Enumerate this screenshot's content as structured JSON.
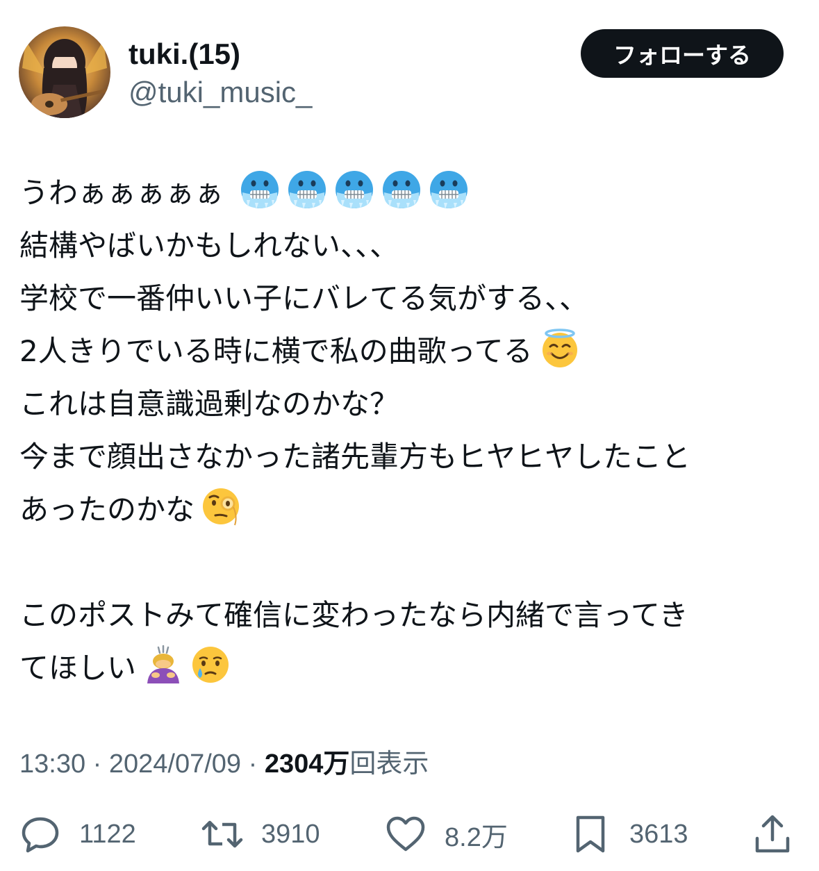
{
  "profile": {
    "display_name": "tuki.(15)",
    "handle": "@tuki_music_"
  },
  "follow_button": {
    "label": "フォローする"
  },
  "tweet": {
    "lines": [
      "うわぁぁぁぁぁ",
      "結構やばいかもしれない、、、",
      "学校で一番仲いい子にバレてる気がする、、",
      "2人きりでいる時に横で私の曲歌ってる",
      "これは自意識過剰なのかな？",
      "今まで顔出さなかった諸先輩方もヒヤヒヤしたこと",
      "あったのかな",
      "このポストみて確信に変わったなら内緒で言ってき",
      "てほしい"
    ],
    "emojis": {
      "line1": [
        "cold-face",
        "cold-face",
        "cold-face",
        "cold-face",
        "cold-face"
      ],
      "line4": [
        "smiling-face-with-halo"
      ],
      "line7": [
        "face-with-monocle"
      ],
      "line9": [
        "person-bowing",
        "face-holding-back-tears"
      ]
    }
  },
  "meta": {
    "time": "13:30",
    "separator": " · ",
    "date": "2024/07/09",
    "views_count": "2304万",
    "views_label": "回表示"
  },
  "actions": {
    "replies": "1122",
    "reposts": "3910",
    "likes": "8.2万",
    "bookmarks": "3613"
  },
  "colors": {
    "text": "#0f1419",
    "secondary": "#536471",
    "button": "#0f1419"
  }
}
